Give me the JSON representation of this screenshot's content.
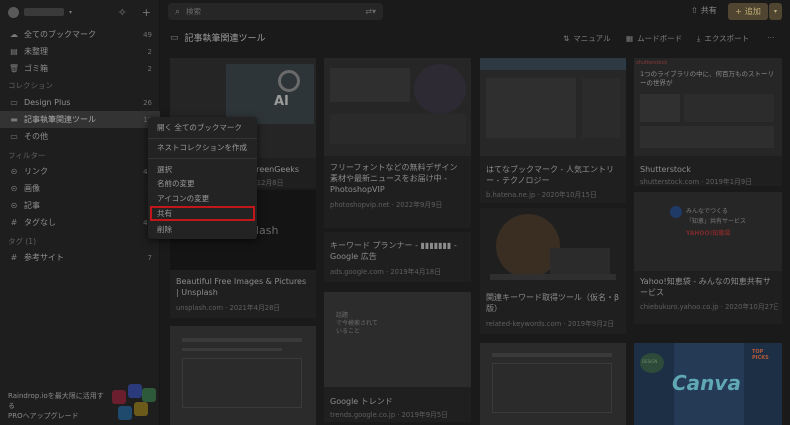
{
  "sidebar": {
    "items": [
      {
        "label": "全てのブックマーク",
        "count": "49",
        "icon": "cloud-icon"
      },
      {
        "label": "未整理",
        "count": "2",
        "icon": "inbox-icon"
      },
      {
        "label": "ゴミ箱",
        "count": "2",
        "icon": "trash-icon"
      }
    ],
    "section_collections": "コレクション",
    "collections": [
      {
        "label": "Design Plus",
        "count": "26"
      },
      {
        "label": "記事執筆関連ツール",
        "count": "16"
      },
      {
        "label": "その他",
        "count": ""
      }
    ],
    "section_filters": "フィルター",
    "filters": [
      {
        "label": "リンク",
        "count": "45"
      },
      {
        "label": "画像",
        "count": "4"
      },
      {
        "label": "記事",
        "count": "4"
      },
      {
        "label": "タグなし",
        "count": "49"
      }
    ],
    "section_tags": "タグ (1)",
    "tags": [
      {
        "label": "参考サイト",
        "count": "7"
      }
    ],
    "upgrade_line1": "Raindrop.ioを最大限に活用す",
    "upgrade_line2": "る",
    "upgrade_line3": "PROへアップグレード"
  },
  "search": {
    "placeholder": "検索"
  },
  "header": {
    "share_label": "共有",
    "add_label": "追加"
  },
  "collection": {
    "title": "記事執筆関連ツール",
    "tools": {
      "sort": "マニュアル",
      "view": "ムードボード",
      "export": "エクスポート",
      "more": "⋯"
    }
  },
  "context_menu": {
    "items": [
      "開く 全てのブックマーク",
      "ネストコレクションを作成",
      "選択",
      "名前の変更",
      "アイコンの変更",
      "共有",
      "削除"
    ],
    "highlighted": "共有"
  },
  "cards": [
    {
      "title": "GreenGeeks",
      "meta": "年12月8日"
    },
    {
      "title": "Beautiful Free Images & Pictures | Unsplash",
      "meta": "unsplash.com · 2021年4月28日"
    },
    {
      "title": "フリーフォントなどの無料デザイン素材や最新ニュースをお届け中 - PhotoshopVIP",
      "meta": "photoshopvip.net · 2022年9月9日"
    },
    {
      "title": "キーワード プランナー - ▮▮▮▮▮▮▮ - Google 広告",
      "meta": "ads.google.com · 2019年4月18日"
    },
    {
      "title": "Google トレンド",
      "meta": "trends.google.co.jp · 2019年9月5日"
    },
    {
      "title": "はてなブックマーク - 人気エントリー - テクノロジー",
      "meta": "b.hatena.ne.jp · 2020年10月15日"
    },
    {
      "title": "関連キーワード取得ツール（仮名・β版）",
      "meta": "related-keywords.com · 2019年9月2日"
    },
    {
      "title": "Shutterstock",
      "meta": "shutterstock.com · 2019年1月9日"
    },
    {
      "title": "Yahoo!知恵袋 - みんなの知恵共有サービス",
      "meta": "chiebukuro.yahoo.co.jp · 2020年10月27日"
    }
  ],
  "thumb_text": {
    "ai": "AI",
    "lash": "lash",
    "shutterstock": "shutterstock",
    "shutterstock_head": "1つのライブラリの中に、何百万ものストーリーの世界が",
    "canva": "Canva",
    "top_picks": "TOP PICKS",
    "design": "DESIGN",
    "chie_line1": "みんなでつくる",
    "chie_line2": "「知恵」共有サービス",
    "yahoo": "YAHOO!知恵袋",
    "trend_t": "話題",
    "trend_l1": "で今検索されて",
    "trend_l2": "いること"
  },
  "colors": {
    "accent_add": "#4f4530",
    "highlight_border": "#c2171a",
    "active_row": "#333333"
  }
}
